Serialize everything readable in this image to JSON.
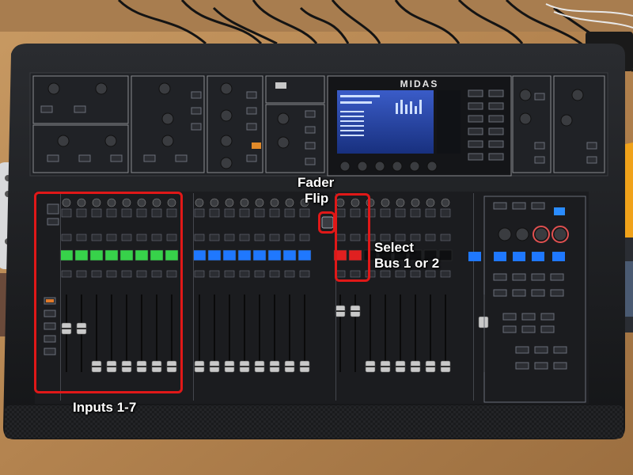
{
  "brand": {
    "logo_text": "MIDAS"
  },
  "annotations": {
    "fader_flip": {
      "line1": "Fader",
      "line2": "Flip"
    },
    "select_bus": {
      "line1": "Select",
      "line2": "Bus 1 or 2"
    },
    "inputs": {
      "label": "Inputs 1-7"
    }
  },
  "colors": {
    "annotation": "#e01818",
    "scribble_green": "#37d24a",
    "scribble_blue": "#1f78ff",
    "scribble_red": "#e02020",
    "console_body": "#1d1f22",
    "table_wood": "#b98a55"
  }
}
